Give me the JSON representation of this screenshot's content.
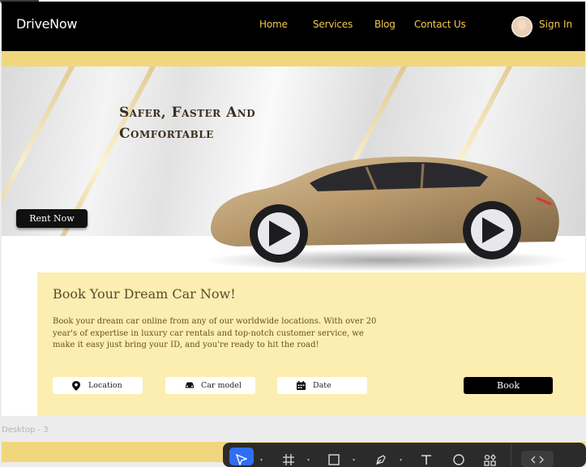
{
  "nav": {
    "logo": "DriveNow",
    "links": [
      "Home",
      "Services",
      "Blog",
      "Contact Us"
    ],
    "signin": "Sign In"
  },
  "hero": {
    "title_line1": "Safer, Faster And",
    "title_line2": "Comfortable",
    "cta": "Rent Now"
  },
  "booking": {
    "title": "Book Your Dream Car Now!",
    "description": "Book your dream car online from any of our worldwide locations. With over 20 year's of expertise in luxury car rentals and top-notch customer service, we make it easy just bring your ID, and you're ready to hit the road!",
    "fields": [
      "Location",
      "Car model",
      "Date"
    ],
    "button": "Book"
  },
  "canvas": {
    "frame_label": "Desktop - 3"
  },
  "toolbar": {
    "tools": [
      "move-tool",
      "frame-tool",
      "rectangle-tool",
      "pen-tool",
      "text-tool",
      "comment-tool",
      "resources-tool",
      "dev-mode-toggle"
    ]
  },
  "colors": {
    "nav_bg": "#000000",
    "accent": "#f5c74a",
    "band": "#f0d77e",
    "booking_bg": "#fbeeb0",
    "toolbar_active": "#2f6ef3"
  }
}
